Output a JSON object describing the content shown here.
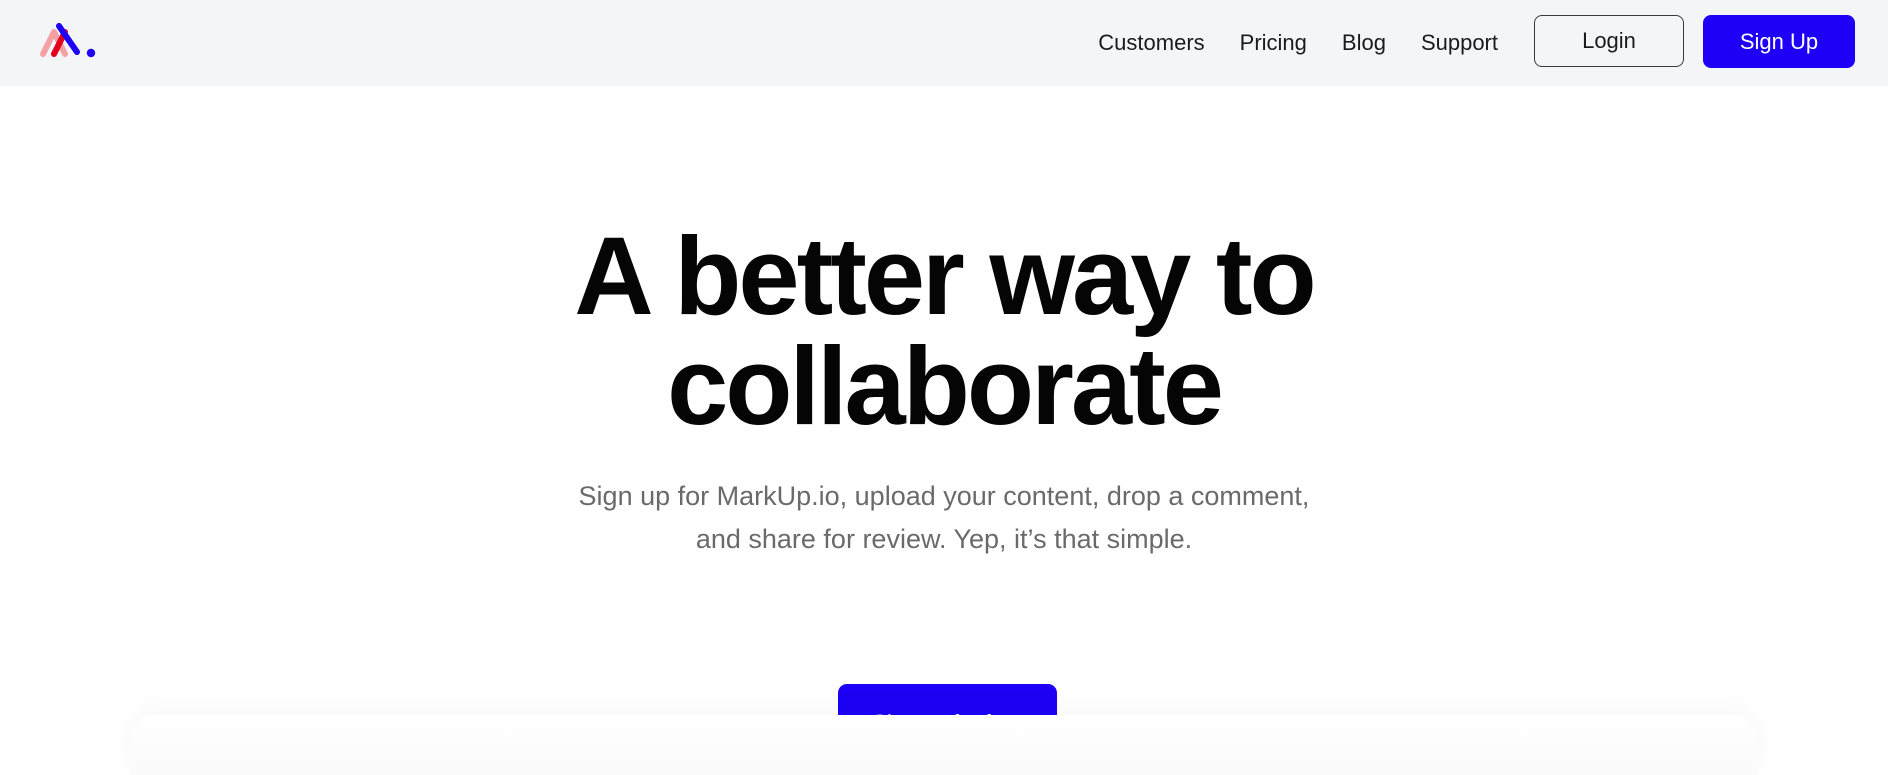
{
  "brand": {
    "logo_icon": "markup-logo-icon",
    "accent_color": "#1d00f5",
    "logo_colors": [
      "#f4a1a6",
      "#e3001b",
      "#1d00f5"
    ]
  },
  "nav": {
    "items": [
      {
        "label": "Customers"
      },
      {
        "label": "Pricing"
      },
      {
        "label": "Blog"
      },
      {
        "label": "Support"
      }
    ],
    "login_label": "Login",
    "signup_label": "Sign Up"
  },
  "hero": {
    "title_line1": "A better way to",
    "title_line2": "collaborate",
    "subtitle_line1": "Sign up for MarkUp.io, upload your content, drop a comment,",
    "subtitle_line2": "and share for review. Yep, it’s that simple.",
    "cta_label": "Sign up for free"
  }
}
